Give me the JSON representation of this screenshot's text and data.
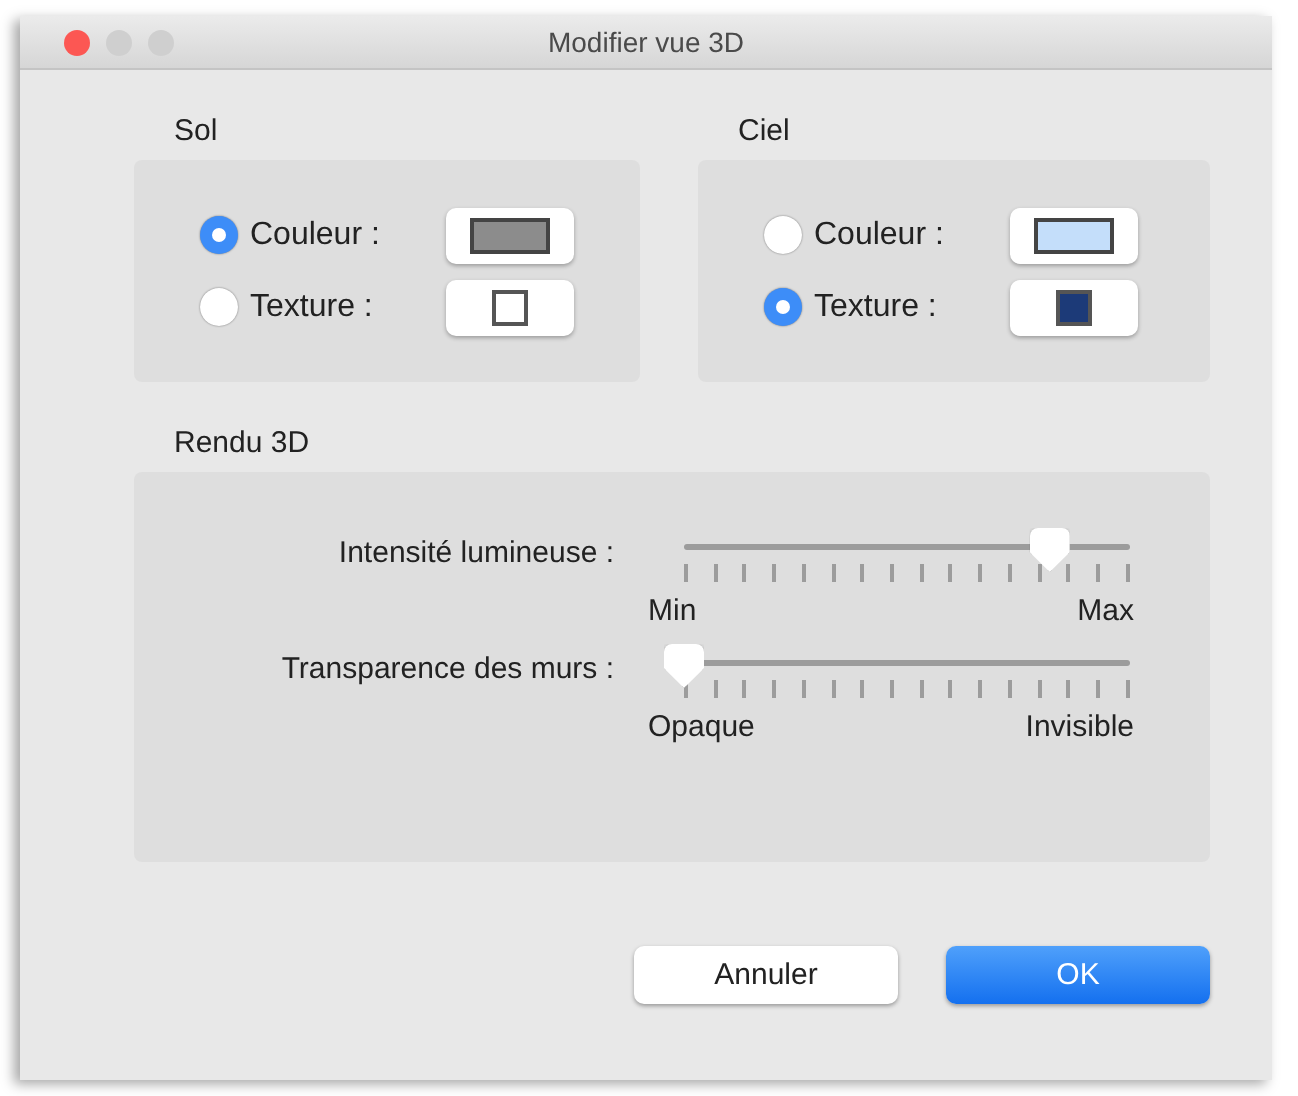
{
  "window": {
    "title": "Modifier vue 3D"
  },
  "groups": [
    {
      "title": "Sol",
      "options": [
        {
          "label": "Couleur :",
          "selected": true,
          "kind": "color",
          "color": "#8c8c8c"
        },
        {
          "label": "Texture :",
          "selected": false,
          "kind": "texture",
          "color": "#ffffff"
        }
      ]
    },
    {
      "title": "Ciel",
      "options": [
        {
          "label": "Couleur :",
          "selected": false,
          "kind": "color",
          "color": "#c4defa"
        },
        {
          "label": "Texture :",
          "selected": true,
          "kind": "texture",
          "color": "#1c3a78"
        }
      ]
    }
  ],
  "render": {
    "title": "Rendu 3D",
    "sliders": [
      {
        "label": "Intensité lumineuse :",
        "level": 0.82,
        "min_label": "Min",
        "max_label": "Max"
      },
      {
        "label": "Transparence des murs :",
        "level": 0,
        "min_label": "Opaque",
        "max_label": "Invisible"
      }
    ]
  },
  "buttons": [
    {
      "label": "Annuler",
      "kind": "cancel"
    },
    {
      "label": "OK",
      "kind": "default"
    }
  ]
}
